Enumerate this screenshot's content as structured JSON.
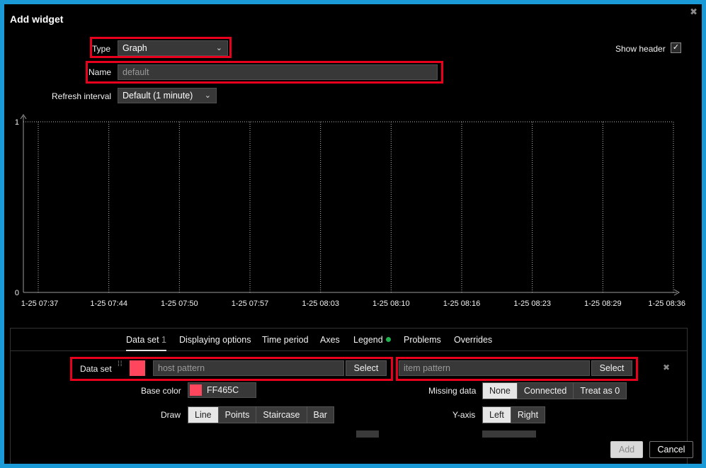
{
  "dialog": {
    "title": "Add widget"
  },
  "form": {
    "type_label": "Type",
    "type_value": "Graph",
    "name_label": "Name",
    "name_placeholder": "default",
    "refresh_label": "Refresh interval",
    "refresh_value": "Default (1 minute)",
    "show_header_label": "Show header",
    "show_header_checked": true
  },
  "chart_data": {
    "type": "line",
    "title": "",
    "xlabel": "",
    "ylabel": "",
    "x_ticks": [
      "1-25 07:37",
      "1-25 07:44",
      "1-25 07:50",
      "1-25 07:57",
      "1-25 08:03",
      "1-25 08:10",
      "1-25 08:16",
      "1-25 08:23",
      "1-25 08:29",
      "1-25 08:36"
    ],
    "y_ticks": [
      "0",
      "1"
    ],
    "ylim": [
      0,
      1
    ],
    "series": [],
    "grid": true
  },
  "tabs": [
    {
      "label": "Data set",
      "count": "1",
      "active": true
    },
    {
      "label": "Displaying options"
    },
    {
      "label": "Time period"
    },
    {
      "label": "Axes"
    },
    {
      "label": "Legend",
      "dot": true
    },
    {
      "label": "Problems"
    },
    {
      "label": "Overrides"
    }
  ],
  "dataset": {
    "label": "Data set",
    "color": "#FF465C",
    "host_placeholder": "host pattern",
    "item_placeholder": "item pattern",
    "select_label": "Select",
    "base_color_label": "Base color",
    "base_color_value": "FF465C",
    "missing_data_label": "Missing data",
    "missing_data_options": [
      "None",
      "Connected",
      "Treat as 0"
    ],
    "missing_data_selected": "None",
    "draw_label": "Draw",
    "draw_options": [
      "Line",
      "Points",
      "Staircase",
      "Bar"
    ],
    "draw_selected": "Line",
    "yaxis_label": "Y-axis",
    "yaxis_options": [
      "Left",
      "Right"
    ],
    "yaxis_selected": "Left"
  },
  "footer": {
    "add_label": "Add",
    "cancel_label": "Cancel"
  }
}
